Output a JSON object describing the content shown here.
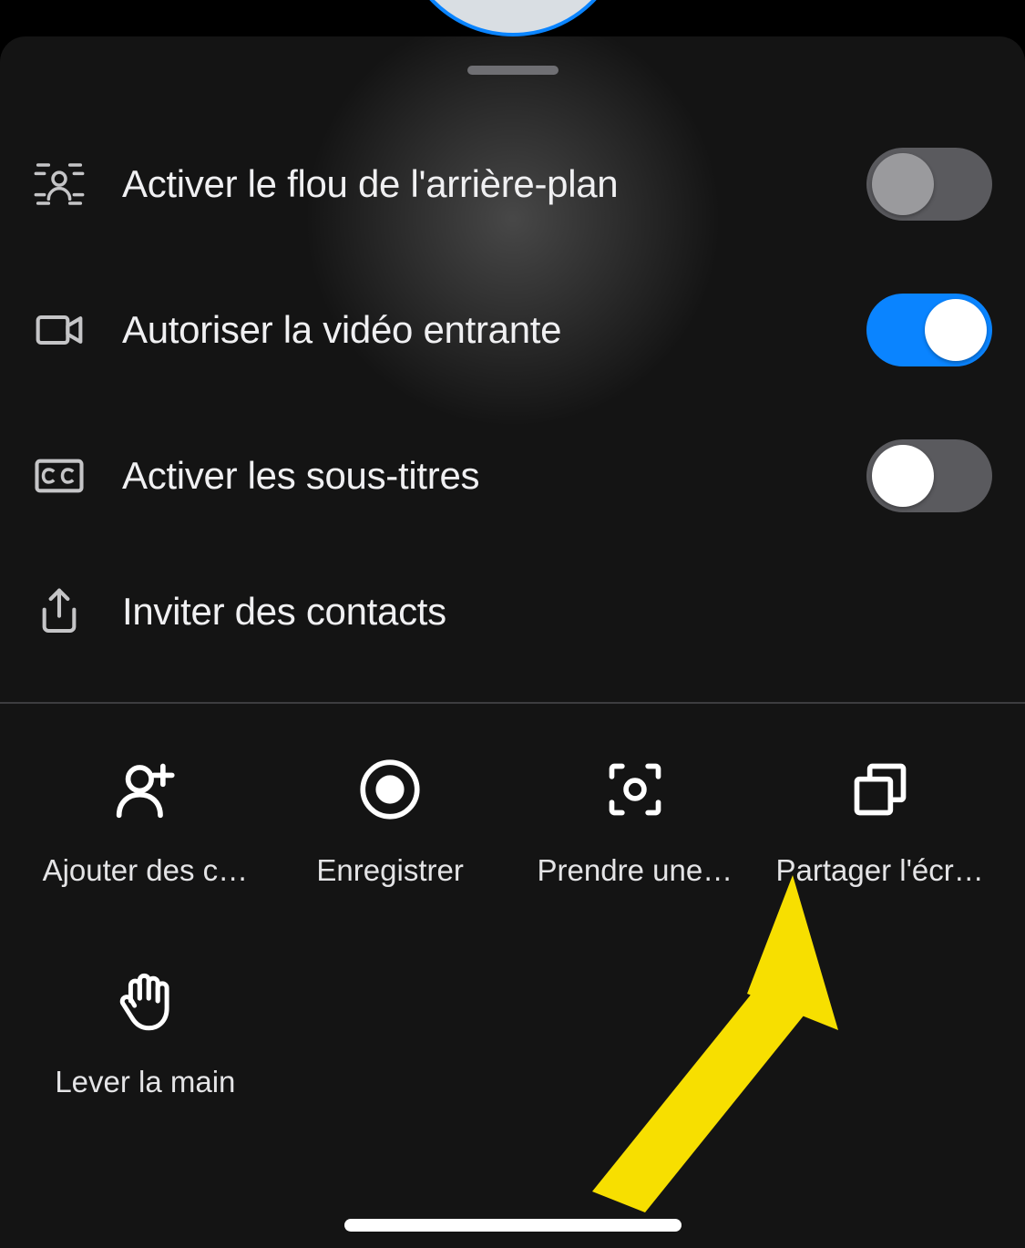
{
  "settings": {
    "blur": {
      "label": "Activer le flou de l'arrière-plan",
      "enabled": false
    },
    "incomingVideo": {
      "label": "Autoriser la vidéo entrante",
      "enabled": true
    },
    "subtitles": {
      "label": "Activer les sous-titres",
      "enabled": false
    },
    "invite": {
      "label": "Inviter des contacts"
    }
  },
  "actions": {
    "addContacts": {
      "label": "Ajouter des c…"
    },
    "record": {
      "label": "Enregistrer"
    },
    "snapshot": {
      "label": "Prendre une…"
    },
    "shareScreen": {
      "label": "Partager l'écr…"
    },
    "raiseHand": {
      "label": "Lever la main"
    }
  },
  "colors": {
    "accent": "#0a84ff",
    "annotation": "#F7DF00"
  }
}
